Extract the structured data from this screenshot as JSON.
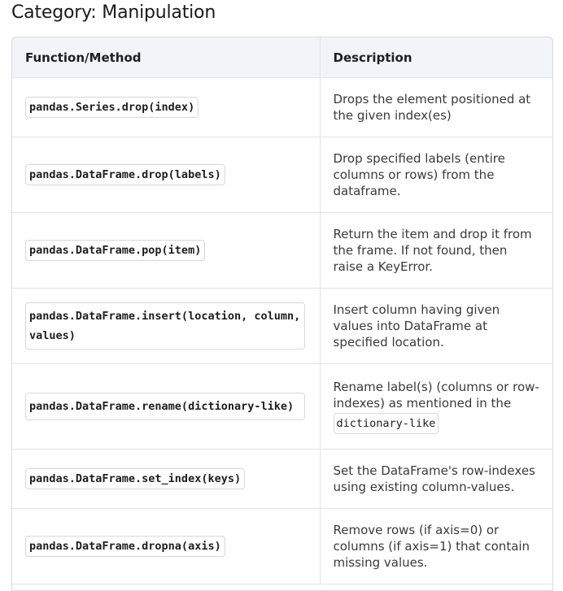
{
  "heading": "Category: Manipulation",
  "columns": {
    "function": "Function/Method",
    "description": "Description"
  },
  "rows": [
    {
      "function": "pandas.Series.drop(index)",
      "description": "Drops the element positioned at the given index(es)"
    },
    {
      "function": "pandas.DataFrame.drop(labels)",
      "description": "Drop specified labels (entire columns or rows) from the dataframe."
    },
    {
      "function": "pandas.DataFrame.pop(item)",
      "description": "Return the item and drop it from the frame. If not found, then raise a KeyError."
    },
    {
      "function": "pandas.DataFrame.insert(location, column, values)",
      "description": "Insert column having given values into DataFrame at specified location."
    },
    {
      "function": "pandas.DataFrame.rename(dictionary-like)",
      "description": "Rename label(s) (columns or row-indexes) as mentioned in the",
      "description_code": "dictionary-like"
    },
    {
      "function": "pandas.DataFrame.set_index(keys)",
      "description": "Set the DataFrame's row-indexes using existing column-values."
    },
    {
      "function": "pandas.DataFrame.dropna(axis)",
      "description": "Remove rows (if axis=0) or columns (if axis=1) that contain missing values."
    }
  ]
}
